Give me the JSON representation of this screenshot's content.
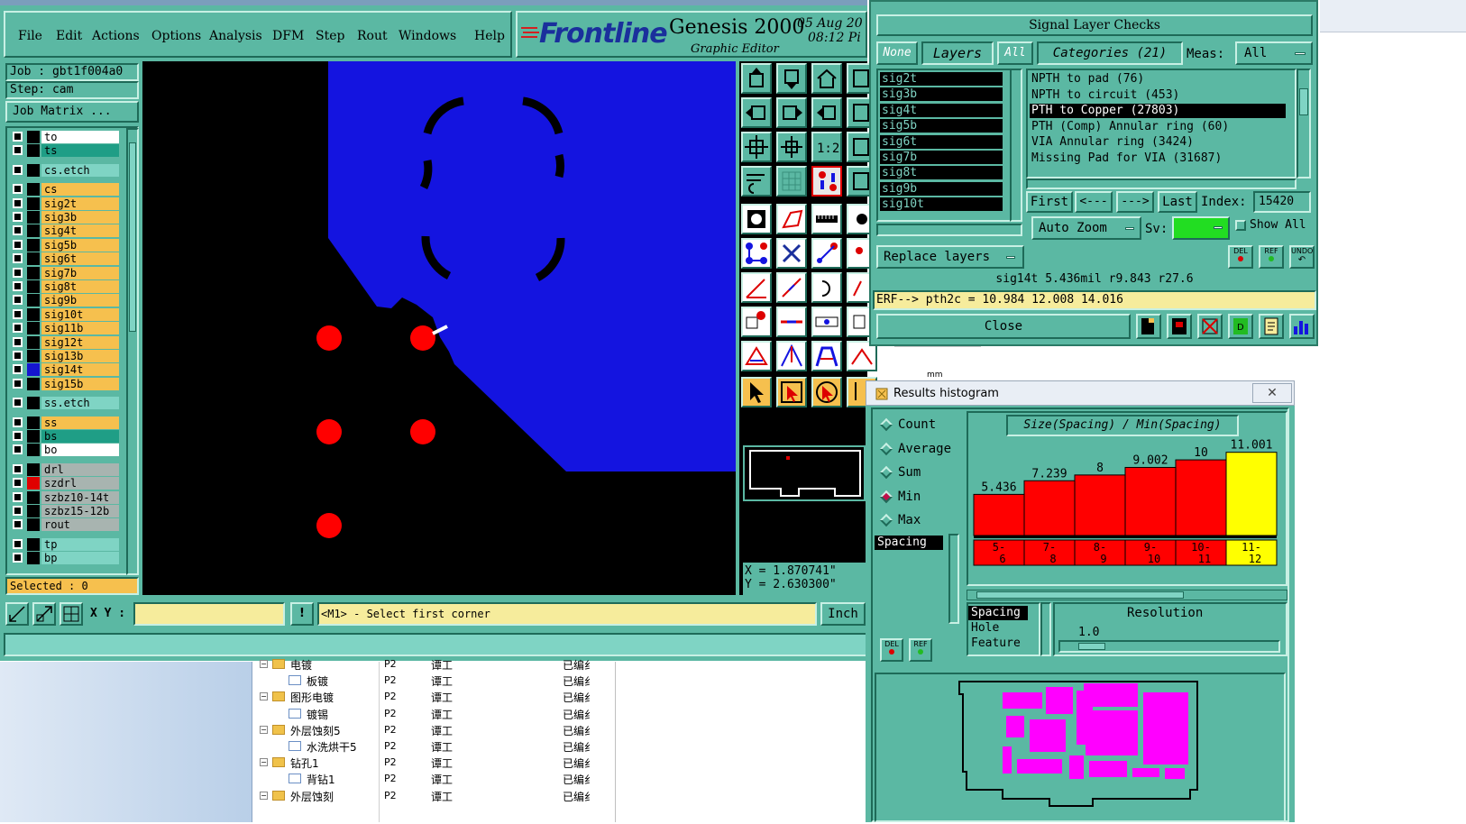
{
  "main_window": {
    "menu": [
      "File",
      "Edit",
      "Actions",
      "Options",
      "Analysis",
      "DFM",
      "Step",
      "Rout",
      "Windows",
      "Help"
    ],
    "brand": {
      "logo": "Frontline",
      "product": "Genesis 2000",
      "subtitle": "Graphic Editor",
      "date_line1": "05 Aug 20",
      "date_line2": "08:12 Pi"
    },
    "job_label": "Job : gbt1f004a0",
    "step_label": "Step: cam",
    "job_matrix_button": "Job Matrix ...",
    "layers": [
      {
        "name": "to",
        "color": "#ffffff",
        "marker": ""
      },
      {
        "name": "ts",
        "color": "#1f9e86",
        "marker": ""
      },
      {
        "name": "cs.etch",
        "color": "#7fd4c4",
        "marker": ""
      },
      {
        "name": "cs",
        "color": "#f6c04e",
        "marker": ""
      },
      {
        "name": "sig2t",
        "color": "#f6c04e",
        "marker": ""
      },
      {
        "name": "sig3b",
        "color": "#f6c04e",
        "marker": ""
      },
      {
        "name": "sig4t",
        "color": "#f6c04e",
        "marker": ""
      },
      {
        "name": "sig5b",
        "color": "#f6c04e",
        "marker": ""
      },
      {
        "name": "sig6t",
        "color": "#f6c04e",
        "marker": ""
      },
      {
        "name": "sig7b",
        "color": "#f6c04e",
        "marker": ""
      },
      {
        "name": "sig8t",
        "color": "#f6c04e",
        "marker": ""
      },
      {
        "name": "sig9b",
        "color": "#f6c04e",
        "marker": ""
      },
      {
        "name": "sig10t",
        "color": "#f6c04e",
        "marker": ""
      },
      {
        "name": "sig11b",
        "color": "#f6c04e",
        "marker": ""
      },
      {
        "name": "sig12t",
        "color": "#f6c04e",
        "marker": ""
      },
      {
        "name": "sig13b",
        "color": "#f6c04e",
        "marker": ""
      },
      {
        "name": "sig14t",
        "color": "#f6c04e",
        "marker": "#1515d0"
      },
      {
        "name": "sig15b",
        "color": "#f6c04e",
        "marker": ""
      },
      {
        "name": "ss.etch",
        "color": "#7fd4c4",
        "marker": ""
      },
      {
        "name": "ss",
        "color": "#f6c04e",
        "marker": ""
      },
      {
        "name": "bs",
        "color": "#1f9e86",
        "marker": ""
      },
      {
        "name": "bo",
        "color": "#ffffff",
        "marker": ""
      },
      {
        "name": "drl",
        "color": "#a8b4b0",
        "marker": ""
      },
      {
        "name": "szdrl",
        "color": "#a8b4b0",
        "marker": "#e00000"
      },
      {
        "name": "szbz10-14t",
        "color": "#a8b4b0",
        "marker": ""
      },
      {
        "name": "szbz15-12b",
        "color": "#a8b4b0",
        "marker": ""
      },
      {
        "name": "rout",
        "color": "#a8b4b0",
        "marker": ""
      },
      {
        "name": "tp",
        "color": "#7fd4c4",
        "marker": ""
      },
      {
        "name": "bp",
        "color": "#7fd4c4",
        "marker": ""
      }
    ],
    "selected_label": "Selected : 0",
    "xy_label": "X Y :",
    "xy_value": "",
    "command_prompt": "<M1> - Select first corner",
    "units_button": "Inch",
    "coords": {
      "x": "X = 1.870741\"",
      "y": "Y = 2.630300\""
    }
  },
  "signal_layer_checks": {
    "title": "Signal Layer Checks",
    "none_btn": "None",
    "layers_btn": "Layers",
    "all_btn": "All",
    "categories_btn": "Categories (21)",
    "meas_label": "Meas:",
    "meas_value": "All",
    "layer_list": [
      "sig2t",
      "sig3b",
      "sig4t",
      "sig5b",
      "sig6t",
      "sig7b",
      "sig8t",
      "sig9b",
      "sig10t"
    ],
    "categories": [
      "NPTH to pad (76)",
      "NPTH to circuit (453)",
      "PTH to Copper (27803)",
      "PTH (Comp) Annular ring (60)",
      "VIA Annular ring (3424)",
      "Missing Pad for VIA (31687)"
    ],
    "selected_category_index": 2,
    "nav": {
      "first": "First",
      "prev": "<---",
      "next": "--->",
      "last": "Last",
      "index_label": "Index:",
      "index_value": "15420"
    },
    "auto_zoom": "Auto Zoom",
    "sv_label": "Sv:",
    "show_all": "Show All",
    "replace_layers": "Replace layers",
    "del": "DEL",
    "ref": "REF",
    "undo": "UNDO",
    "info_line": "sig14t 5.436mil  r9.843  r27.6",
    "erf_line": "ERF--> pth2c = 10.984 12.008 14.016",
    "close_btn": "Close"
  },
  "histogram": {
    "window_title": "Results histogram",
    "modes": [
      "Count",
      "Average",
      "Sum",
      "Min",
      "Max"
    ],
    "selected_mode": "Min",
    "chart_title": "Size(Spacing) / Min(Spacing)",
    "list_selected": "Spacing",
    "size_options": [
      "Spacing",
      "Hole",
      "Feature"
    ],
    "resolution_label": "Resolution",
    "resolution_value": "1.0",
    "del": "DEL",
    "ref": "REF",
    "colors": {
      "bar": "#ff0000",
      "highlight": "#ffff00"
    }
  },
  "chart_data": {
    "type": "bar",
    "title": "Size(Spacing) / Min(Spacing)",
    "categories": [
      "5-6",
      "7-8",
      "8-9",
      "9-10",
      "10-11",
      "11-12"
    ],
    "values": [
      5.436,
      7.239,
      8,
      9.002,
      10,
      11.001
    ],
    "value_labels": [
      "5.436",
      "7.239",
      "8",
      "9.002",
      "10",
      "11.001"
    ],
    "highlight_index": 5
  },
  "file_list": {
    "rows": [
      {
        "indent": 0,
        "folder": true,
        "name": "电镀",
        "col2": "P2",
        "col3": "谭工",
        "col4": "已编纟"
      },
      {
        "indent": 1,
        "folder": false,
        "name": "板镀",
        "col2": "P2",
        "col3": "谭工",
        "col4": "已编纟"
      },
      {
        "indent": 0,
        "folder": true,
        "name": "图形电镀",
        "col2": "P2",
        "col3": "谭工",
        "col4": "已编纟"
      },
      {
        "indent": 1,
        "folder": false,
        "name": "镀锡",
        "col2": "P2",
        "col3": "谭工",
        "col4": "已编纟"
      },
      {
        "indent": 0,
        "folder": true,
        "name": "外层蚀刻5",
        "col2": "P2",
        "col3": "谭工",
        "col4": "已编纟"
      },
      {
        "indent": 1,
        "folder": false,
        "name": "水洗烘干5",
        "col2": "P2",
        "col3": "谭工",
        "col4": "已编纟"
      },
      {
        "indent": 0,
        "folder": true,
        "name": "钻孔1",
        "col2": "P2",
        "col3": "谭工",
        "col4": "已编纟"
      },
      {
        "indent": 1,
        "folder": false,
        "name": "背钻1",
        "col2": "P2",
        "col3": "谭工",
        "col4": "已编纟"
      },
      {
        "indent": 0,
        "folder": true,
        "name": "外层蚀刻",
        "col2": "P2",
        "col3": "谭工",
        "col4": "已编纟"
      }
    ],
    "unit_text": "mm"
  }
}
